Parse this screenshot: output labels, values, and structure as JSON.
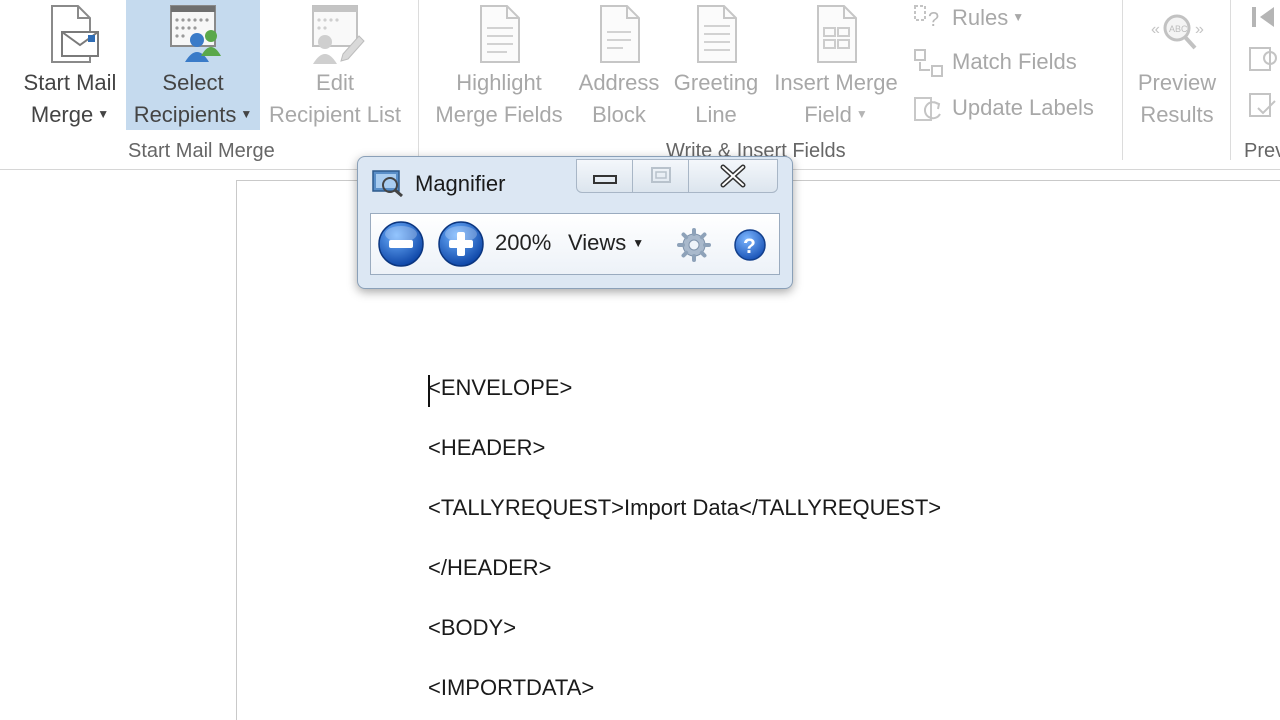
{
  "ribbon": {
    "start_mail_merge": {
      "line1": "Start Mail",
      "line2": "Merge"
    },
    "select_recipients": {
      "line1": "Select",
      "line2": "Recipients"
    },
    "edit_recipient_list": {
      "line1": "Edit",
      "line2": "Recipient List"
    },
    "highlight_merge_fields": {
      "line1": "Highlight",
      "line2": "Merge Fields"
    },
    "address_block": {
      "line1": "Address",
      "line2": "Block"
    },
    "greeting_line": {
      "line1": "Greeting",
      "line2": "Line"
    },
    "insert_merge_field": {
      "line1": "Insert Merge",
      "line2": "Field"
    },
    "rules": "Rules",
    "match_fields": "Match Fields",
    "update_labels": "Update Labels",
    "preview_results": {
      "line1": "Preview",
      "line2": "Results"
    },
    "groups": {
      "start_mail_merge": "Start Mail Merge",
      "write_insert_fields": "Write & Insert Fields",
      "preview": "Prev"
    }
  },
  "magnifier": {
    "title": "Magnifier",
    "zoom": "200%",
    "views": "Views"
  },
  "document": {
    "lines": [
      "<ENVELOPE>",
      "<HEADER>",
      "<TALLYREQUEST>Import Data</TALLYREQUEST>",
      "</HEADER>",
      "<BODY>",
      "<IMPORTDATA>"
    ]
  },
  "colors": {
    "accent_selected": "#c5daee",
    "disabled_text": "#a8a8a8",
    "magnifier_frame": "#dce7f3",
    "zoom_button": "#1c5fc4"
  }
}
